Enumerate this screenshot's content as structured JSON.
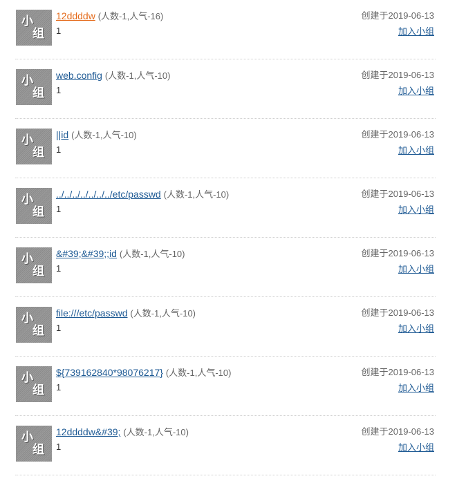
{
  "groups": [
    {
      "name": "12ddddw",
      "stats": "(人数-1,人气-16)",
      "desc": "1",
      "created": "创建于2019-06-13",
      "join_label": "加入小组",
      "avatar_text": [
        "小",
        "组"
      ],
      "link_color": "#e46a1a"
    },
    {
      "name": "web.config",
      "stats": "(人数-1,人气-10)",
      "desc": "1",
      "created": "创建于2019-06-13",
      "join_label": "加入小组",
      "avatar_text": [
        "小",
        "组"
      ],
      "link_color": "#1e5a94"
    },
    {
      "name": "||id",
      "stats": "(人数-1,人气-10)",
      "desc": "1",
      "created": "创建于2019-06-13",
      "join_label": "加入小组",
      "avatar_text": [
        "小",
        "组"
      ],
      "link_color": "#1e5a94"
    },
    {
      "name": "../../../../../../../etc/passwd",
      "stats": "(人数-1,人气-10)",
      "desc": "1",
      "created": "创建于2019-06-13",
      "join_label": "加入小组",
      "avatar_text": [
        "小",
        "组"
      ],
      "link_color": "#1e5a94"
    },
    {
      "name": "&#39;&#39;;id",
      "stats": "(人数-1,人气-10)",
      "desc": "1",
      "created": "创建于2019-06-13",
      "join_label": "加入小组",
      "avatar_text": [
        "小",
        "组"
      ],
      "link_color": "#1e5a94"
    },
    {
      "name": "file:///etc/passwd",
      "stats": "(人数-1,人气-10)",
      "desc": "1",
      "created": "创建于2019-06-13",
      "join_label": "加入小组",
      "avatar_text": [
        "小",
        "组"
      ],
      "link_color": "#1e5a94"
    },
    {
      "name": "${739162840*98076217}",
      "stats": "(人数-1,人气-10)",
      "desc": "1",
      "created": "创建于2019-06-13",
      "join_label": "加入小组",
      "avatar_text": [
        "小",
        "组"
      ],
      "link_color": "#1e5a94"
    },
    {
      "name": "12ddddw&#39;",
      "stats": "(人数-1,人气-10)",
      "desc": "1",
      "created": "创建于2019-06-13",
      "join_label": "加入小组",
      "avatar_text": [
        "小",
        "组"
      ],
      "link_color": "#1e5a94"
    }
  ]
}
